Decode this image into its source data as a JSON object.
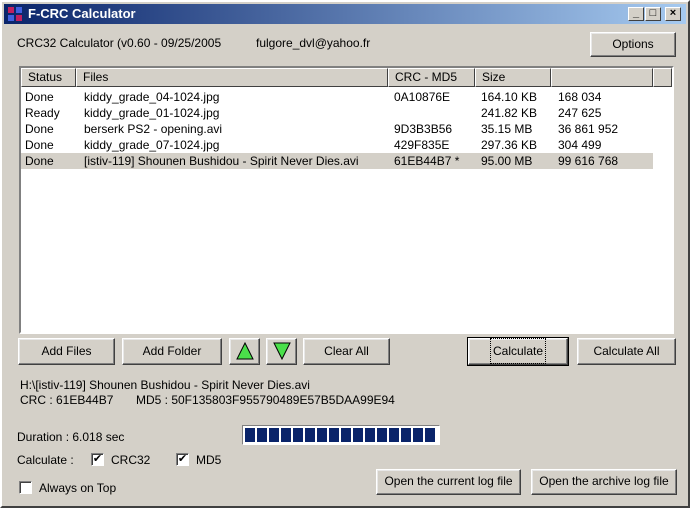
{
  "window": {
    "title": "F-CRC Calculator"
  },
  "titlebar_buttons": {
    "minimize": "_",
    "maximize": "□",
    "close": "×"
  },
  "header": {
    "app_info": "CRC32 Calculator (v0.60 - 09/25/2005",
    "email": "fulgore_dvl@yahoo.fr",
    "options_label": "Options"
  },
  "list": {
    "columns": [
      "Status",
      "Files",
      "CRC - MD5",
      "Size",
      ""
    ],
    "rows": [
      {
        "status": "Done",
        "file": "kiddy_grade_04-1024.jpg",
        "crc": "0A10876E",
        "size": "164.10 KB",
        "bytes": "168 034",
        "selected": false
      },
      {
        "status": "Ready",
        "file": "kiddy_grade_01-1024.jpg",
        "crc": "",
        "size": "241.82 KB",
        "bytes": "247 625",
        "selected": false
      },
      {
        "status": "Done",
        "file": "berserk PS2 - opening.avi",
        "crc": "9D3B3B56",
        "size": "35.15 MB",
        "bytes": "36 861 952",
        "selected": false
      },
      {
        "status": "Done",
        "file": "kiddy_grade_07-1024.jpg",
        "crc": "429F835E",
        "size": "297.36 KB",
        "bytes": "304 499",
        "selected": false
      },
      {
        "status": "Done",
        "file": "[istiv-119] Shounen Bushidou - Spirit Never Dies.avi",
        "crc": "61EB44B7 *",
        "size": "95.00 MB",
        "bytes": "99 616 768",
        "selected": true
      }
    ]
  },
  "buttons": {
    "add_files": "Add Files",
    "add_folder": "Add Folder",
    "clear_all": "Clear All",
    "calculate": "Calculate",
    "calculate_all": "Calculate All",
    "open_current_log": "Open the current log file",
    "open_archive_log": "Open the archive log file"
  },
  "details": {
    "path": "H:\\[istiv-119] Shounen Bushidou - Spirit Never Dies.avi",
    "crc": "CRC : 61EB44B7",
    "md5": "MD5 : 50F135803F955790489E57B5DAA99E94"
  },
  "status": {
    "duration": "Duration : 6.018 sec",
    "progress": 1.0,
    "calculate_label": "Calculate :",
    "crc32_label": "CRC32",
    "crc32_checked": true,
    "md5_label": "MD5",
    "md5_checked": true,
    "always_on_top_label": "Always on Top",
    "always_on_top_checked": false
  },
  "colors": {
    "titlebar_start": "#0a246a",
    "titlebar_end": "#a6caf0",
    "arrow_green": "#4ae04a",
    "progress": "#0a246a"
  }
}
